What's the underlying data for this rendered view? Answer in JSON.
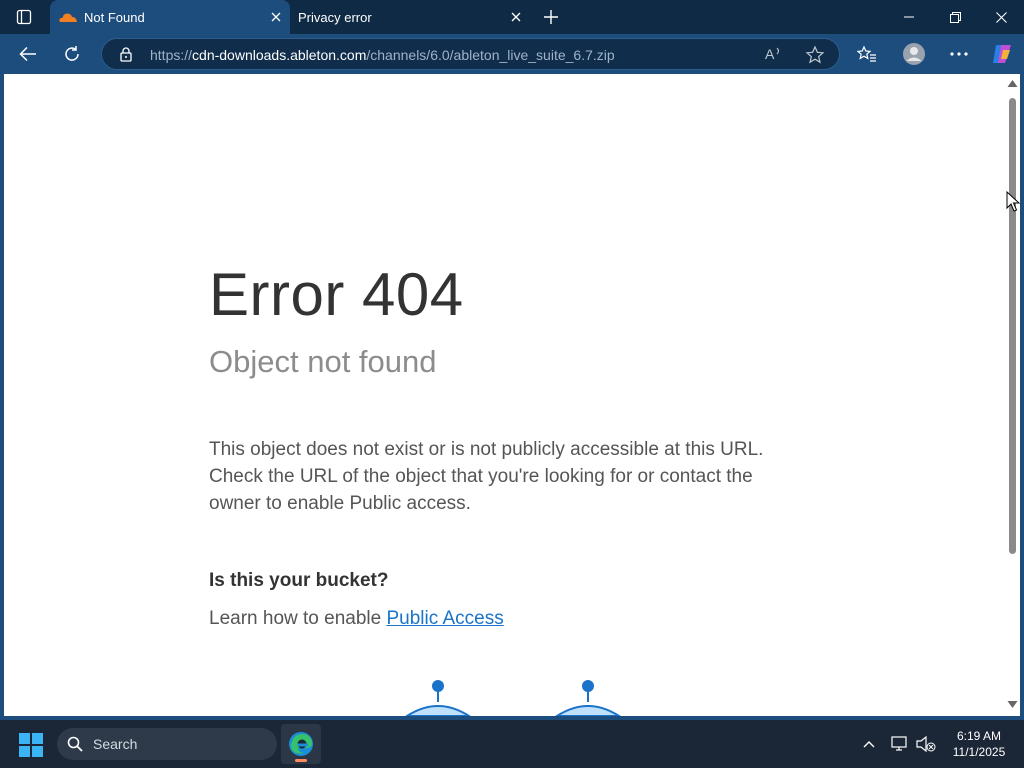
{
  "browser": {
    "tabs": [
      {
        "title": "Not Found",
        "favicon": "cloudflare-icon",
        "active": true
      },
      {
        "title": "Privacy error",
        "favicon": "",
        "active": false
      }
    ],
    "address": {
      "scheme": "https://",
      "host": "cdn-downloads.ableton.com",
      "path": "/channels/6.0/ableton_live_suite_6.7.zip"
    },
    "colors": {
      "frame": "#0f2a44",
      "active_tab": "#1d4d7d",
      "link": "#1a73c9",
      "tab_favicon": "#f38020"
    }
  },
  "page": {
    "title": "Error 404",
    "subtitle": "Object not found",
    "description": "This object does not exist or is not publicly accessible at this URL. Check the URL of the object that you're looking for or contact the owner to enable Public access.",
    "bucket_question": "Is this your bucket?",
    "learn_prefix": "Learn how to enable ",
    "learn_link": "Public Access"
  },
  "taskbar": {
    "search_label": "Search",
    "time": "6:19 AM",
    "date": "11/1/2025",
    "pinned": [
      "edge-icon"
    ]
  }
}
